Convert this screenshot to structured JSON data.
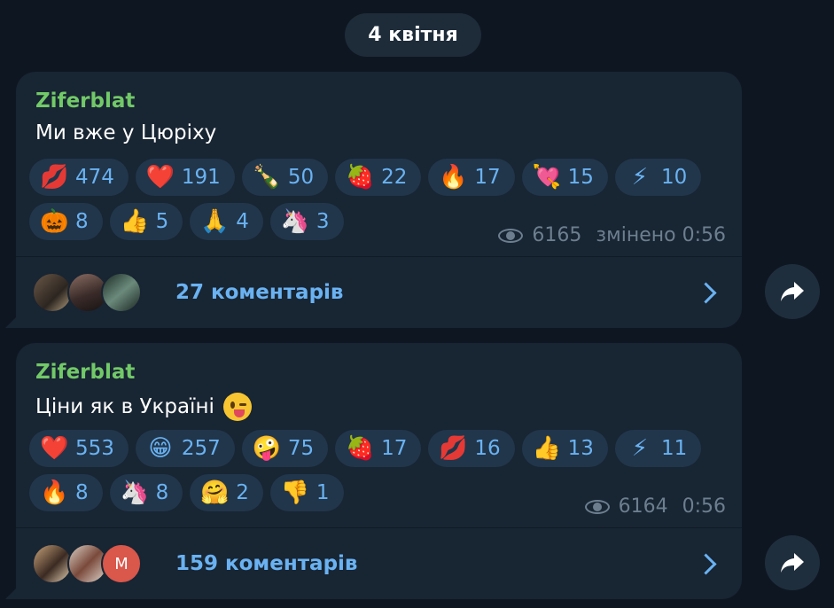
{
  "date_separator": "4 квітня",
  "messages": [
    {
      "author": "Ziferblat",
      "text": "Ми вже у Цюріху",
      "reactions_row1": [
        {
          "icon": "kiss-lips-icon",
          "emoji": "💋",
          "count": "474"
        },
        {
          "icon": "heart-icon",
          "emoji": "❤️",
          "count": "191"
        },
        {
          "icon": "champagne-icon",
          "emoji": "🍾",
          "count": "50"
        },
        {
          "icon": "strawberry-icon",
          "emoji": "🍓",
          "count": "22"
        },
        {
          "icon": "fire-icon",
          "emoji": "🔥",
          "count": "17"
        },
        {
          "icon": "heart-arrow-icon",
          "emoji": "💘",
          "count": "15"
        },
        {
          "icon": "lightning-icon",
          "emoji": "⚡",
          "count": "10"
        }
      ],
      "reactions_row2": [
        {
          "icon": "pumpkin-icon",
          "emoji": "🎃",
          "count": "8"
        },
        {
          "icon": "thumbs-up-icon",
          "emoji": "👍",
          "count": "5"
        },
        {
          "icon": "praying-hands-icon",
          "emoji": "🙏",
          "count": "4"
        },
        {
          "icon": "unicorn-icon",
          "emoji": "🦄",
          "count": "3"
        }
      ],
      "views": "6165",
      "time": "змінено 0:56",
      "comments": "27 коментарів"
    },
    {
      "author": "Ziferblat",
      "text": "Ціни як в Україні",
      "reactions_row1": [
        {
          "icon": "heart-icon",
          "emoji": "❤️",
          "count": "553"
        },
        {
          "icon": "grinning-face-icon",
          "emoji": "😁",
          "count": "257"
        },
        {
          "icon": "zany-face-icon",
          "emoji": "🤪",
          "count": "75"
        },
        {
          "icon": "strawberry-icon",
          "emoji": "🍓",
          "count": "17"
        },
        {
          "icon": "kiss-lips-icon",
          "emoji": "💋",
          "count": "16"
        },
        {
          "icon": "thumbs-up-icon",
          "emoji": "👍",
          "count": "13"
        },
        {
          "icon": "lightning-icon",
          "emoji": "⚡",
          "count": "11"
        }
      ],
      "reactions_row2": [
        {
          "icon": "fire-icon",
          "emoji": "🔥",
          "count": "8"
        },
        {
          "icon": "unicorn-icon",
          "emoji": "🦄",
          "count": "8"
        },
        {
          "icon": "hugging-face-icon",
          "emoji": "🤗",
          "count": "2"
        },
        {
          "icon": "thumbs-down-icon",
          "emoji": "👎",
          "count": "1"
        }
      ],
      "views": "6164",
      "time": "0:56",
      "comments": "159 коментарів",
      "avatar_letter": "M"
    }
  ],
  "colors": {
    "background": "#0e1621",
    "bubble": "#182533",
    "author": "#72c968",
    "accent": "#6ab2f2",
    "meta": "#6d7f8f"
  }
}
